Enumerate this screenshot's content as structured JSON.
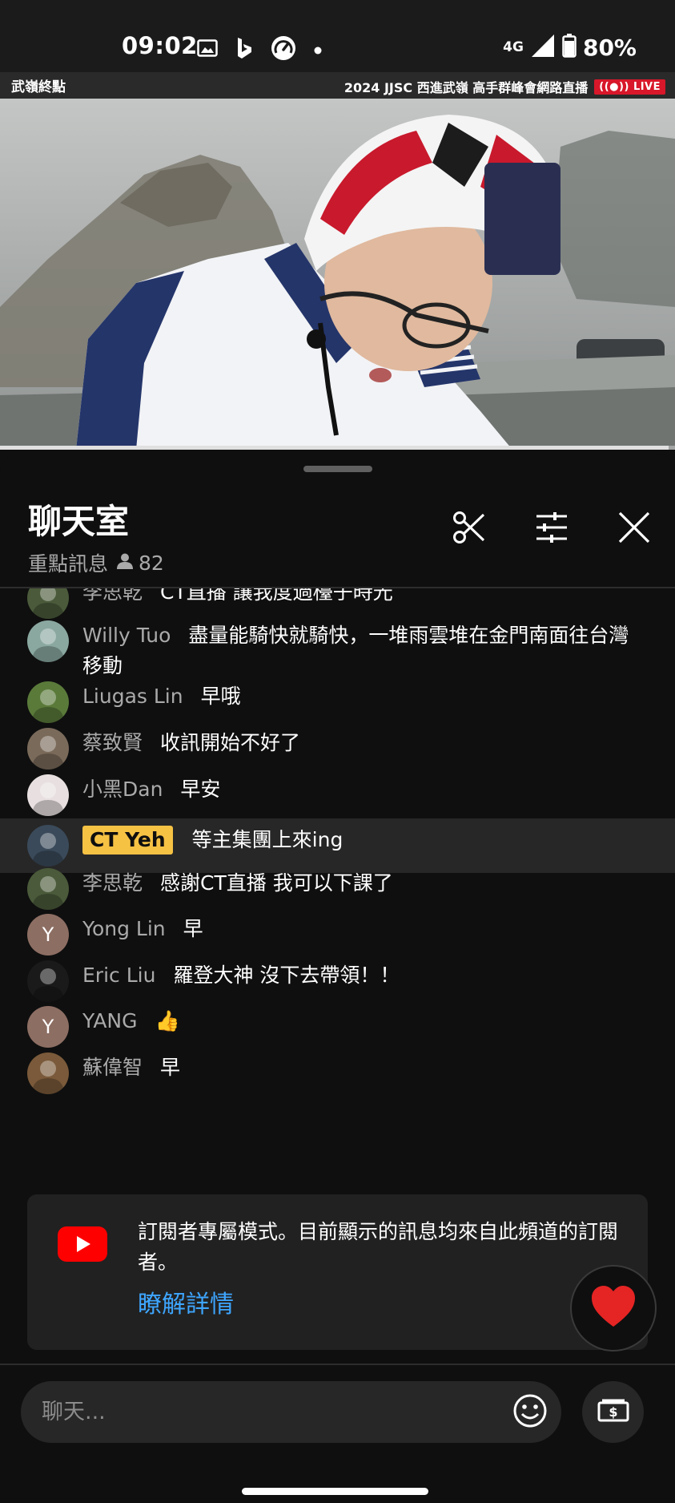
{
  "status_bar": {
    "time": "09:02",
    "network": "4G",
    "battery": "80%",
    "icons": [
      "gallery-icon",
      "bing-icon",
      "speedometer-icon",
      "dot-icon",
      "signal-icon",
      "battery-icon"
    ]
  },
  "video": {
    "overlay_left": "武嶺終點",
    "overlay_right": "2024  JJSC 西進武嶺 高手群峰會網路直播",
    "live_label": "LIVE",
    "progress_fraction": 0.99
  },
  "chat": {
    "title": "聊天室",
    "mode": "重點訊息",
    "viewer_count": "82",
    "messages": [
      {
        "author": "李思乾",
        "text": "CT直播 讓我度過檯子時光",
        "avatar_type": "photo",
        "avatar_color": "#4a5a3a"
      },
      {
        "author": "Willy Tuo",
        "text": "盡量能騎快就騎快，一堆雨雲堆在金門南面往台灣移動",
        "avatar_type": "photo",
        "avatar_color": "#8aa8a0"
      },
      {
        "author": "Liugas Lin",
        "text": "早哦",
        "avatar_type": "photo",
        "avatar_color": "#5a7a3a"
      },
      {
        "author": "蔡致賢",
        "text": "收訊開始不好了",
        "avatar_type": "photo",
        "avatar_color": "#7a6a5a"
      },
      {
        "author": "小黑Dan",
        "text": "早安",
        "avatar_type": "photo",
        "avatar_color": "#e8e0e0"
      },
      {
        "author": "CT Yeh",
        "text": "等主集團上來ing",
        "avatar_type": "photo",
        "avatar_color": "#3a4a5a",
        "owner": true
      },
      {
        "author": "李思乾",
        "text": "感謝CT直播 我可以下課了",
        "avatar_type": "photo",
        "avatar_color": "#4a5a3a"
      },
      {
        "author": "Yong Lin",
        "text": "早",
        "avatar_type": "letter",
        "avatar_letter": "Y",
        "avatar_color": "#8d6e63"
      },
      {
        "author": "Eric Liu",
        "text": "羅登大神 沒下去帶領！！",
        "avatar_type": "photo",
        "avatar_color": "#1a1a1a"
      },
      {
        "author": "YANG",
        "text": "👍",
        "avatar_type": "letter",
        "avatar_letter": "Y",
        "avatar_color": "#8d6e63"
      },
      {
        "author": "蘇偉智",
        "text": "早",
        "avatar_type": "photo",
        "avatar_color": "#7a5a3a"
      }
    ]
  },
  "notice": {
    "text": "訂閱者專屬模式。目前顯示的訊息均來自此頻道的訂閱者。",
    "link": "瞭解詳情"
  },
  "input": {
    "placeholder": "聊天..."
  },
  "colors": {
    "background": "#0f0f0f",
    "owner_badge": "#f6c244",
    "link": "#3ea6ff",
    "live_red": "#d8172a"
  }
}
